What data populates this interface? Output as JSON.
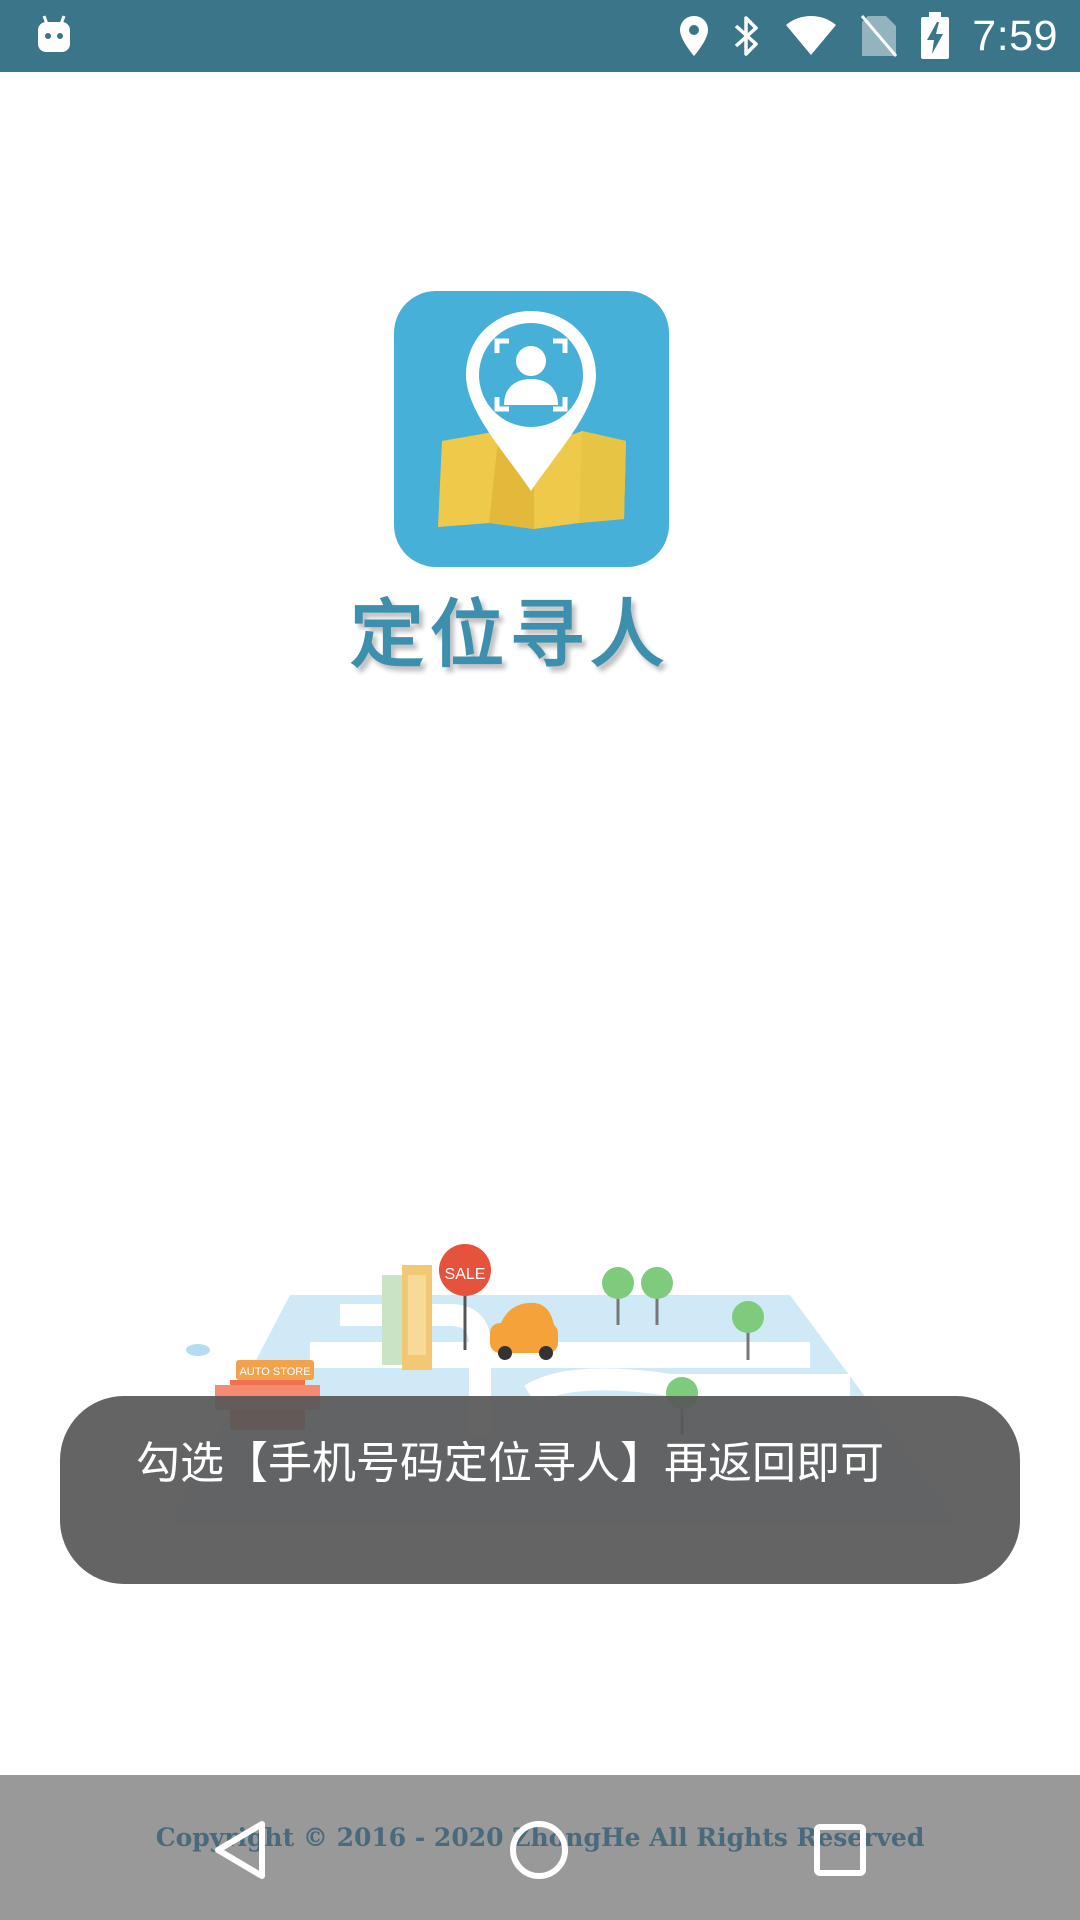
{
  "status_bar": {
    "time": "7:59",
    "icons": [
      "android-icon",
      "location-icon",
      "bluetooth-icon",
      "wifi-icon",
      "no-sim-icon",
      "battery-charging-icon"
    ],
    "background_color": "#3b7589"
  },
  "app": {
    "name": "定位寻人",
    "logo_icon": "location-pin-map-icon",
    "brand_color": "#47b0d9"
  },
  "illustration": {
    "sale_sign": "SALE",
    "store_sign": "AUTO STORE"
  },
  "toast": {
    "message": "勾选【手机号码定位寻人】再返回即可"
  },
  "footer": {
    "copyright": "Copyright © 2016 - 2020 ZhongHe All Rights Reserved"
  },
  "nav_bar": {
    "buttons": [
      "back-icon",
      "home-icon",
      "recents-icon"
    ]
  }
}
